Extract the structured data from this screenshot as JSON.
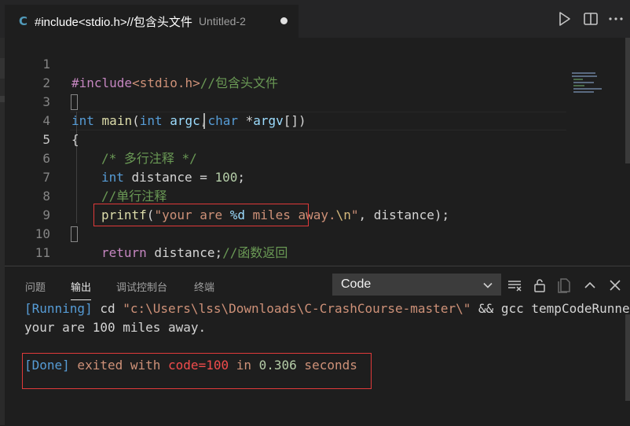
{
  "tab": {
    "language_icon": "C",
    "title": "#include<stdio.h>//包含头文件",
    "description": "Untitled-2"
  },
  "toolbar": {
    "run_icon": "run-icon",
    "split_icon": "split-editor-icon",
    "more_icon": "more-icon"
  },
  "editor": {
    "line_numbers": [
      "1",
      "2",
      "3",
      "4",
      "5",
      "6",
      "7",
      "8",
      "9",
      "10",
      "11"
    ],
    "active_line": "5",
    "lines": {
      "l1": {
        "directive": "#include",
        "header": "<stdio.h>",
        "comment": "//包含头文件"
      },
      "l3": {
        "type1": "int",
        "func": "main",
        "paren_open": "(",
        "type2": "int",
        "param1": "argc",
        "comma": ",",
        "type3": "char",
        "star": " *",
        "param2": "argv",
        "brackets": "[]",
        "paren_close": ")"
      },
      "l4": {
        "brace": "{"
      },
      "l5": {
        "comment": "/* 多行注释 */"
      },
      "l6": {
        "type": "int",
        "decl": " distance = ",
        "value": "100",
        "semi": ";"
      },
      "l7": {
        "comment": "//单行注释"
      },
      "l8": {
        "func": "printf",
        "open": "(",
        "str1": "\"your are ",
        "fmt": "%d",
        "str2": " miles away.",
        "esc": "\\n",
        "str3": "\"",
        "rest": ", distance);"
      },
      "l10": {
        "kw": "return",
        "rest": " distance;",
        "comment": "//函数返回"
      },
      "l11": {
        "brace": "}"
      }
    }
  },
  "panel": {
    "tabs": [
      "问题",
      "输出",
      "调试控制台",
      "终端"
    ],
    "active_tab": "输出",
    "dropdown_value": "Code",
    "output": {
      "running_tag": "[Running]",
      "command_prefix": " cd ",
      "command_path": "\"c:\\Users\\lss\\Downloads\\C-CrashCourse-master\\\"",
      "command_rest": " && gcc tempCodeRunne",
      "program_output": "your are 100 miles away.",
      "done_tag": "[Done]",
      "exited_text": " exited with ",
      "code_text": "code=100",
      "in_text": " in ",
      "time_value": "0.306",
      "seconds_text": " seconds"
    }
  },
  "colors": {
    "background": "#1e1e1e",
    "highlight_border": "#e03a3a",
    "keyword": "#569cd6",
    "comment": "#6a9955"
  }
}
